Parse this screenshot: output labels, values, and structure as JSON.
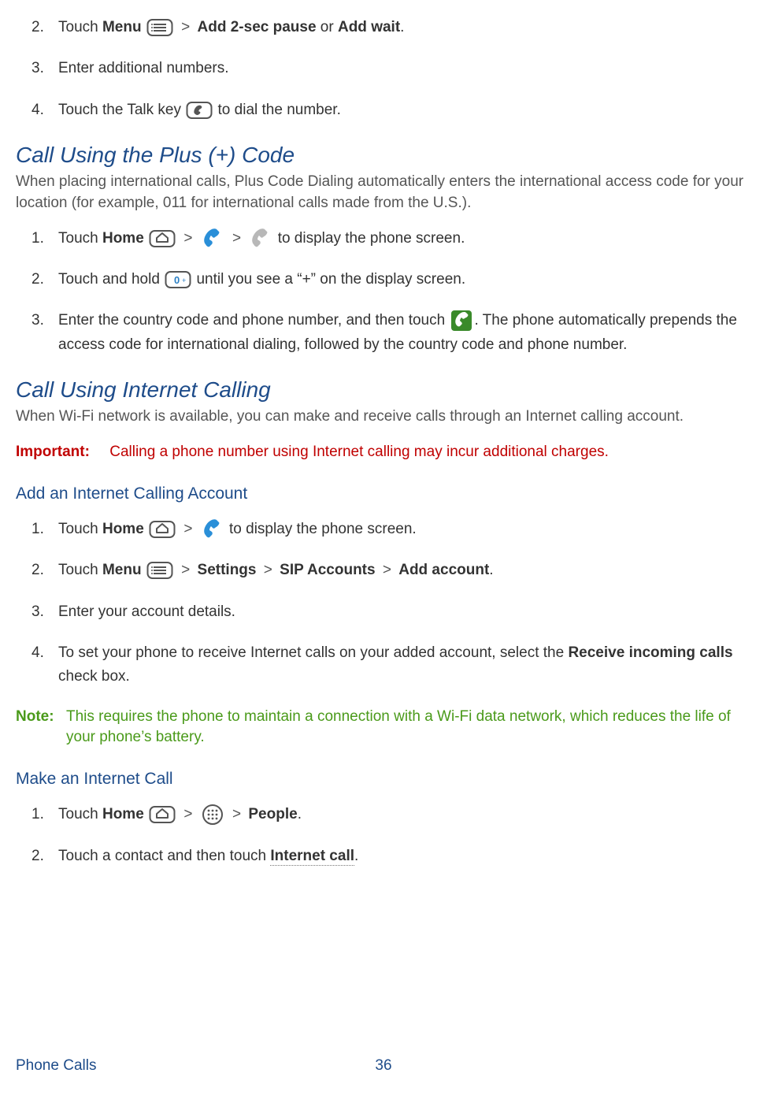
{
  "topSteps": {
    "s2": {
      "num": "2.",
      "pre": "Touch ",
      "menu": "Menu",
      "post1": " > ",
      "opt1": "Add 2-sec pause",
      "or": " or ",
      "opt2": "Add wait",
      "tail": "."
    },
    "s3": {
      "num": "3.",
      "text": "Enter additional numbers."
    },
    "s4": {
      "num": "4.",
      "pre": "Touch the Talk key ",
      "post": " to dial the number."
    }
  },
  "plus": {
    "heading": "Call Using the Plus (+) Code",
    "intro": "When placing international calls, Plus Code Dialing automatically enters the international access code for your location (for example, 011 for international calls made from the U.S.).",
    "s1": {
      "num": "1.",
      "pre": "Touch ",
      "home": "Home",
      "post": " to display the phone screen."
    },
    "s2": {
      "num": "2.",
      "pre": "Touch and hold ",
      "post": " until you see a “+” on the display screen."
    },
    "s3": {
      "num": "3.",
      "pre": "Enter the country code and phone number, and then touch ",
      "post": ". The phone automatically prepends the access code for international dialing, followed by the country code and phone number."
    }
  },
  "internet": {
    "heading": "Call Using Internet Calling",
    "intro": "When Wi-Fi network is available, you can make and receive calls through an Internet calling account.",
    "important": {
      "label": "Important:",
      "text": "Calling a phone number using Internet calling may incur additional charges."
    },
    "addHeading": "Add an Internet Calling Account",
    "add": {
      "s1": {
        "num": "1.",
        "pre": "Touch ",
        "home": "Home",
        "post": " to display the phone screen."
      },
      "s2": {
        "num": "2.",
        "pre": "Touch ",
        "menu": "Menu",
        "gt1": " > ",
        "b1": "Settings",
        "gt2": " > ",
        "b2": "SIP Accounts",
        "gt3": " > ",
        "b3": "Add account",
        "tail": "."
      },
      "s3": {
        "num": "3.",
        "text": "Enter your account details."
      },
      "s4": {
        "num": "4.",
        "pre": "To set your phone to receive Internet calls on your added account, select the ",
        "b1": "Receive incoming calls",
        "post": " check box."
      }
    },
    "note": {
      "label": "Note:",
      "text": "This requires the phone to maintain a connection with a Wi-Fi data network, which reduces the life of your phone’s battery."
    },
    "makeHeading": "Make an Internet Call",
    "make": {
      "s1": {
        "num": "1.",
        "pre": "Touch ",
        "home": "Home",
        "gt1": " > ",
        "gt2": " > ",
        "people": "People",
        "tail": "."
      },
      "s2": {
        "num": "2.",
        "pre": "Touch a contact and then touch ",
        "link": "Internet call",
        "tail": "."
      }
    }
  },
  "footer": {
    "section": "Phone Calls",
    "page": "36"
  },
  "icons": {
    "menu": "menu-key-icon",
    "talk": "talk-key-icon",
    "home": "home-key-icon",
    "phoneApp": "phone-app-icon",
    "dialpad": "dialpad-icon",
    "zeroPlus": "zero-plus-key-icon",
    "callGreen": "call-green-icon",
    "appsGrid": "apps-grid-icon"
  }
}
